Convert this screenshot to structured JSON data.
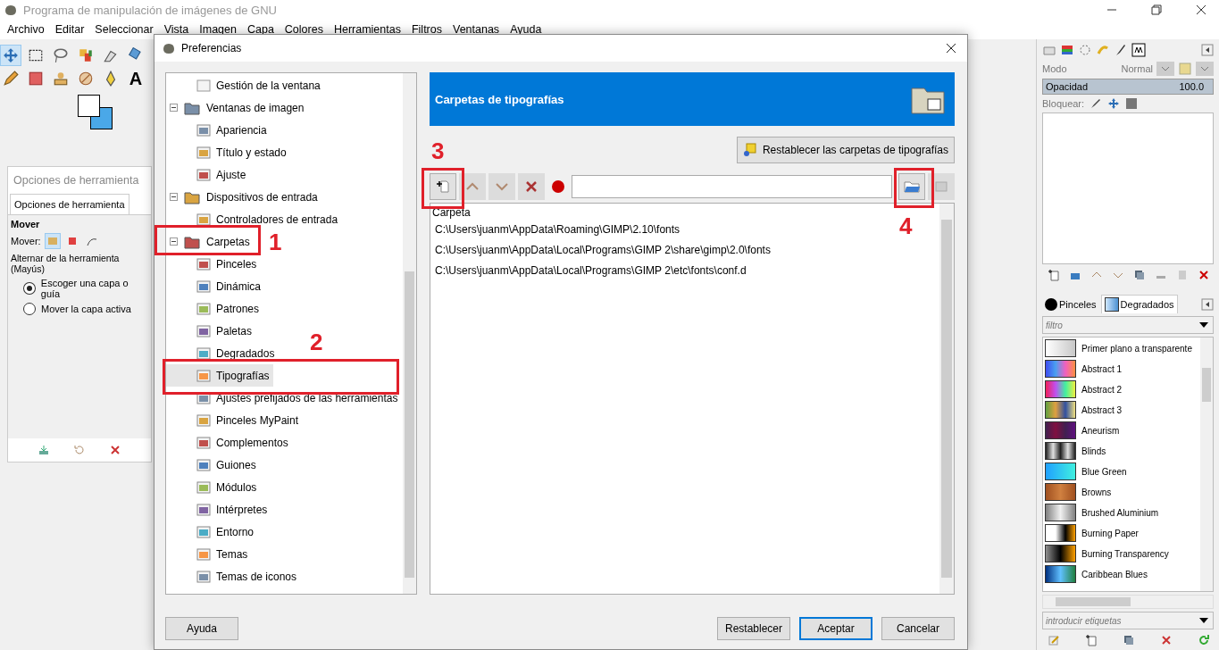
{
  "window": {
    "title": "Programa de manipulación de imágenes de GNU"
  },
  "menu": [
    "Archivo",
    "Editar",
    "Seleccionar",
    "Vista",
    "Imagen",
    "Capa",
    "Colores",
    "Herramientas",
    "Filtros",
    "Ventanas",
    "Ayuda"
  ],
  "toolbox": {
    "tools": [
      {
        "kind": "move",
        "selected": true
      },
      {
        "kind": "rect",
        "selected": false
      },
      {
        "kind": "lasso",
        "selected": false
      },
      {
        "kind": "swatch",
        "selected": false
      },
      {
        "kind": "pen",
        "selected": false
      },
      {
        "kind": "transform",
        "selected": false
      },
      {
        "kind": "pencil",
        "selected": false
      },
      {
        "kind": "square",
        "selected": false
      },
      {
        "kind": "stamp",
        "selected": false
      },
      {
        "kind": "smudge",
        "selected": false
      },
      {
        "kind": "ink",
        "selected": false
      },
      {
        "kind": "text",
        "glyph": "A",
        "selected": false
      }
    ]
  },
  "tool_options": {
    "title": "Opciones de herramienta",
    "tab": "Opciones de herramienta",
    "tool": "Mover",
    "mode_label": "Mover:",
    "mode_buttons": [
      {
        "selected": true
      },
      {
        "selected": false
      },
      {
        "selected": false
      }
    ],
    "toggle_label": "Alternar de la herramienta  (Mayús)",
    "radios": [
      {
        "label": "Escoger una capa o guía",
        "checked": true
      },
      {
        "label": "Mover la capa activa",
        "checked": false
      }
    ]
  },
  "dialog": {
    "title": "Preferencias",
    "tree": {
      "scrolled_children": [
        {
          "label": "Gestión de la ventana",
          "selected": false
        }
      ],
      "items": [
        {
          "label": "Ventanas de imagen",
          "expanded": true,
          "selected": false,
          "children": [
            {
              "label": "Apariencia",
              "selected": false
            },
            {
              "label": "Título y estado",
              "selected": false
            },
            {
              "label": "Ajuste",
              "selected": false
            }
          ]
        },
        {
          "label": "Dispositivos de entrada",
          "expanded": true,
          "selected": false,
          "children": [
            {
              "label": "Controladores de entrada",
              "selected": false
            }
          ]
        },
        {
          "label": "Carpetas",
          "expanded": true,
          "selected": false,
          "children": [
            {
              "label": "Pinceles",
              "selected": false
            },
            {
              "label": "Dinámica",
              "selected": false
            },
            {
              "label": "Patrones",
              "selected": false
            },
            {
              "label": "Paletas",
              "selected": false
            },
            {
              "label": "Degradados",
              "selected": false
            },
            {
              "label": "Tipografías",
              "selected": true
            },
            {
              "label": "Ajustes prefijados de las herramientas",
              "selected": false
            },
            {
              "label": "Pinceles MyPaint",
              "selected": false
            },
            {
              "label": "Complementos",
              "selected": false
            },
            {
              "label": "Guiones",
              "selected": false
            },
            {
              "label": "Módulos",
              "selected": false
            },
            {
              "label": "Intérpretes",
              "selected": false
            },
            {
              "label": "Entorno",
              "selected": false
            },
            {
              "label": "Temas",
              "selected": false
            },
            {
              "label": "Temas de iconos",
              "selected": false
            }
          ]
        }
      ]
    },
    "header": "Carpetas de tipografías",
    "reset_button": "Restablecer las carpetas de tipografías",
    "list_header": "Carpeta",
    "folders": [
      "C:\\Users\\juanm\\AppData\\Roaming\\GIMP\\2.10\\fonts",
      "C:\\Users\\juanm\\AppData\\Local\\Programs\\GIMP 2\\share\\gimp\\2.0\\fonts",
      "C:\\Users\\juanm\\AppData\\Local\\Programs\\GIMP 2\\etc\\fonts\\conf.d"
    ],
    "buttons": [
      {
        "label": "Ayuda",
        "default": false
      },
      {
        "label": "Restablecer",
        "default": false
      },
      {
        "label": "Aceptar",
        "default": true
      },
      {
        "label": "Cancelar",
        "default": false
      }
    ]
  },
  "annotations": [
    {
      "label": "1"
    },
    {
      "label": "2"
    },
    {
      "label": "3"
    },
    {
      "label": "4"
    }
  ],
  "layers": {
    "mode_label": "Modo",
    "mode_value": "Normal",
    "opacity_label": "Opacidad",
    "opacity_value": "100.0",
    "level": 1,
    "lock_label": "Bloquear:"
  },
  "resources": {
    "tabs": [
      {
        "label": "Pinceles",
        "selected": false
      },
      {
        "label": "Degradados",
        "selected": true
      }
    ],
    "filter_placeholder": "filtro",
    "gradients": [
      {
        "name": "Primer plano a transparente"
      },
      {
        "name": "Abstract 1"
      },
      {
        "name": "Abstract 2"
      },
      {
        "name": "Abstract 3"
      },
      {
        "name": "Aneurism"
      },
      {
        "name": "Blinds"
      },
      {
        "name": "Blue Green"
      },
      {
        "name": "Browns"
      },
      {
        "name": "Brushed Aluminium"
      },
      {
        "name": "Burning Paper"
      },
      {
        "name": "Burning Transparency"
      },
      {
        "name": "Caribbean Blues"
      }
    ],
    "tags_placeholder": "introducir etiquetas"
  }
}
